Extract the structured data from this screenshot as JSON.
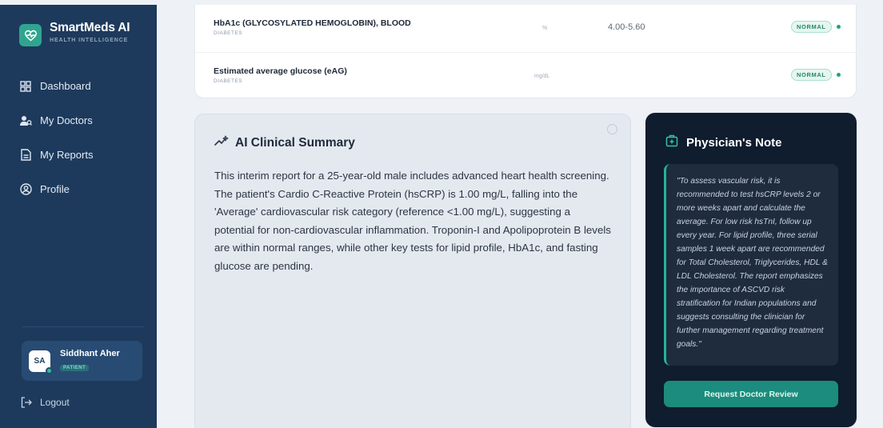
{
  "brand": {
    "name": "SmartMeds AI",
    "subtitle": "HEALTH INTELLIGENCE"
  },
  "nav": [
    {
      "label": "Dashboard",
      "icon": "dashboard-icon"
    },
    {
      "label": "My Doctors",
      "icon": "doctors-icon"
    },
    {
      "label": "My Reports",
      "icon": "reports-icon"
    },
    {
      "label": "Profile",
      "icon": "profile-icon"
    }
  ],
  "user": {
    "initials": "SA",
    "name": "Siddhant Aher",
    "role": "PATIENT"
  },
  "logout_label": "Logout",
  "results": [
    {
      "name": "HbA1c (GLYCOSYLATED HEMOGLOBIN), BLOOD",
      "category": "DIABETES",
      "unit": "%",
      "range": "4.00-5.60",
      "status": "NORMAL"
    },
    {
      "name": "Estimated average glucose (eAG)",
      "category": "DIABETES",
      "unit": "mg/dL",
      "range": "",
      "status": "NORMAL"
    }
  ],
  "summary": {
    "title": "AI Clinical Summary",
    "text": "This interim report for a 25-year-old male includes advanced heart health screening. The patient's Cardio C-Reactive Protein (hsCRP) is 1.00 mg/L, falling into the 'Average' cardiovascular risk category (reference <1.00 mg/L), suggesting a potential for non-cardiovascular inflammation. Troponin-I and Apolipoprotein B levels are within normal ranges, while other key tests for lipid profile, HbA1c, and fasting glucose are pending."
  },
  "note": {
    "title": "Physician's Note",
    "text": "\"To assess vascular risk, it is recommended to test hsCRP levels 2 or more weeks apart and calculate the average. For low risk hsTnI, follow up every year. For lipid profile, three serial samples 1 week apart are recommended for Total Cholesterol, Triglycerides, HDL & LDL Cholesterol. The report emphasizes the importance of ASCVD risk stratification for Indian populations and suggests consulting the clinician for further management regarding treatment goals.\"",
    "button_label": "Request Doctor Review"
  },
  "colors": {
    "sidebar": "#1d3a5c",
    "accent": "#1b8c7d",
    "normal": "#22a37a",
    "note_bg": "#0f1d2e"
  }
}
